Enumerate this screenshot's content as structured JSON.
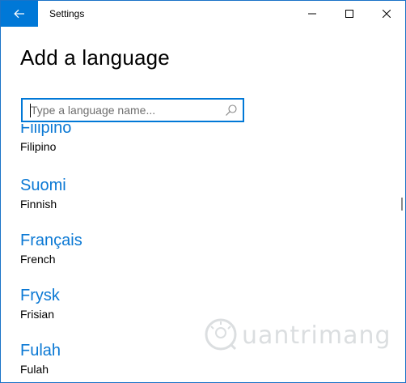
{
  "window": {
    "title": "Settings"
  },
  "page": {
    "heading": "Add a language"
  },
  "search": {
    "placeholder": "Type a language name...",
    "value": ""
  },
  "languages": [
    {
      "native": "Filipino",
      "english": "Filipino"
    },
    {
      "native": "Suomi",
      "english": "Finnish"
    },
    {
      "native": "Français",
      "english": "French"
    },
    {
      "native": "Frysk",
      "english": "Frisian"
    },
    {
      "native": "Fulah",
      "english": "Fulah"
    }
  ],
  "watermark": {
    "text": "uantrimang"
  },
  "icons": {
    "back": "back-arrow-icon",
    "minimize": "minimize-icon",
    "maximize": "maximize-icon",
    "close": "close-icon",
    "search": "search-icon"
  },
  "colors": {
    "accent": "#0078d7",
    "link": "#0a78d4"
  }
}
